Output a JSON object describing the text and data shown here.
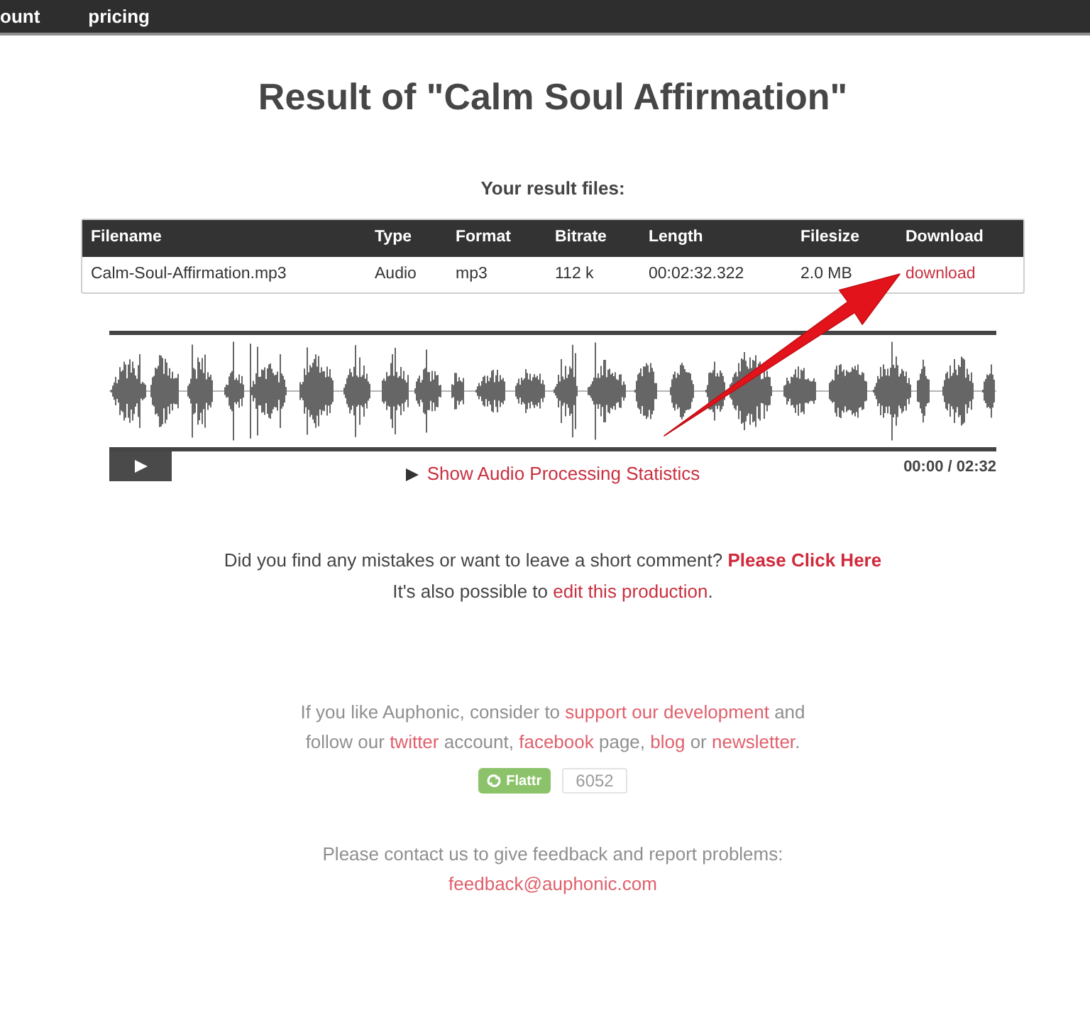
{
  "nav": {
    "links": [
      "ount",
      "pricing"
    ]
  },
  "title": "Result of \"Calm Soul Affirmation\"",
  "results": {
    "heading": "Your result files:",
    "columns": [
      "Filename",
      "Type",
      "Format",
      "Bitrate",
      "Length",
      "Filesize",
      "Download"
    ],
    "rows": [
      {
        "cells": [
          "Calm-Soul-Affirmation.mp3",
          "Audio",
          "mp3",
          "112 k",
          "00:02:32.322",
          "2.0 MB"
        ],
        "download": "download"
      }
    ]
  },
  "player": {
    "time": "00:00 / 02:32",
    "stats_link": "Show Audio Processing Statistics"
  },
  "comment": [
    {
      "kind": "text",
      "text": "Did you find any mistakes or want to leave a short comment? "
    },
    {
      "kind": "strong_link",
      "text": "Please Click Here"
    }
  ],
  "edit_note": [
    {
      "kind": "text",
      "text": "It's also possible to "
    },
    {
      "kind": "link",
      "text": "edit this production"
    },
    {
      "kind": "text",
      "text": "."
    }
  ],
  "support": {
    "text": [
      {
        "kind": "text",
        "text": "If you like Auphonic, consider to "
      },
      {
        "kind": "link",
        "text": "support our development"
      },
      {
        "kind": "text",
        "text": " and follow our "
      },
      {
        "kind": "link",
        "text": "twitter"
      },
      {
        "kind": "text",
        "text": " account, "
      },
      {
        "kind": "link",
        "text": "facebook"
      },
      {
        "kind": "text",
        "text": " page, "
      },
      {
        "kind": "link",
        "text": "blog"
      },
      {
        "kind": "text",
        "text": " or "
      },
      {
        "kind": "link",
        "text": "newsletter"
      },
      {
        "kind": "text",
        "text": "."
      }
    ],
    "flattr": {
      "label": "Flattr",
      "count": "6052"
    }
  },
  "contact": {
    "text": "Please contact us to give feedback and report problems:",
    "email": "feedback@auphonic.com"
  }
}
